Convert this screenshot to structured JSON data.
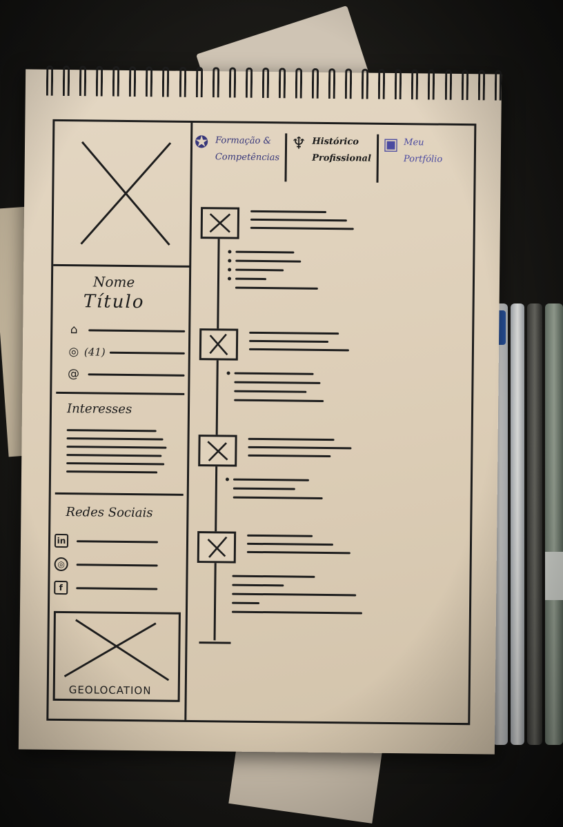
{
  "sidebar": {
    "name": "Nome",
    "title": "Título",
    "contacts": [
      {
        "icon": "home-icon",
        "glyph": "⌂",
        "text": ""
      },
      {
        "icon": "whatsapp-icon",
        "glyph": "◎",
        "text": "(41)"
      },
      {
        "icon": "email-icon",
        "glyph": "@",
        "text": ""
      }
    ],
    "interests_label": "Interesses",
    "social_label": "Redes Sociais",
    "social": [
      {
        "icon": "linkedin-icon",
        "glyph": "in"
      },
      {
        "icon": "whatsapp-icon",
        "glyph": "◎"
      },
      {
        "icon": "facebook-icon",
        "glyph": "f"
      }
    ],
    "geolocation_label": "GEOLOCATION"
  },
  "tabs": [
    {
      "icon": "award-ribbon-icon",
      "glyph": "✪",
      "label_1": "Formação &",
      "label_2": "Competências"
    },
    {
      "icon": "necktie-icon",
      "glyph": "♆",
      "label_1": "Histórico",
      "label_2": "Profissional"
    },
    {
      "icon": "briefcase-icon",
      "glyph": "▣",
      "label_1": "Meu",
      "label_2": "Portfólio"
    }
  ],
  "colors": {
    "paper": "#dccdb6",
    "ink": "#1d1d1d",
    "blue_ink": "#36367a"
  }
}
